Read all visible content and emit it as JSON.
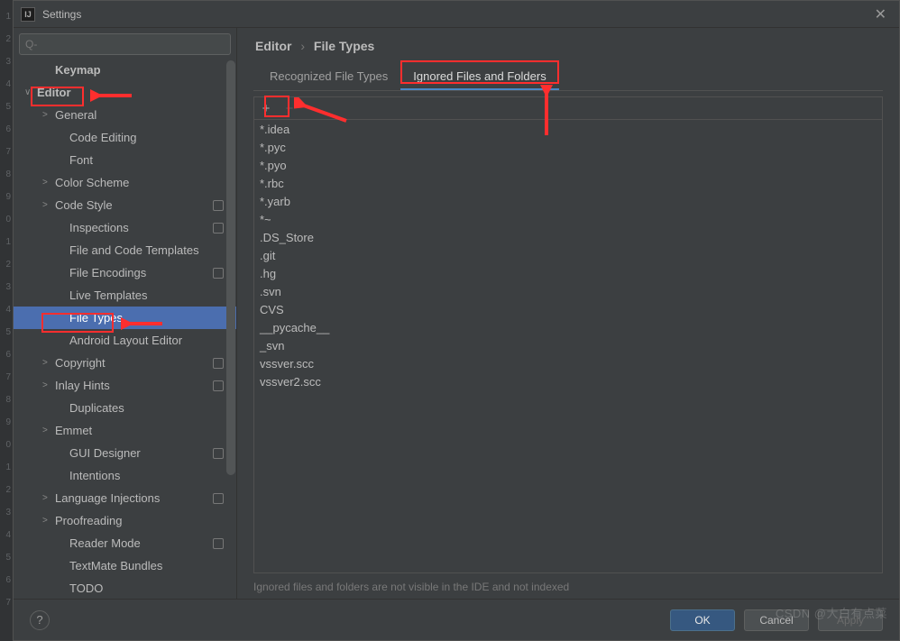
{
  "window": {
    "title": "Settings",
    "close_glyph": "✕",
    "app_glyph": "IJ"
  },
  "search": {
    "placeholder": "Q-"
  },
  "breadcrumb": {
    "a": "Editor",
    "sep": "›",
    "b": "File Types"
  },
  "sidebar": {
    "items": [
      {
        "label": "Keymap",
        "depth": 1,
        "chev": "",
        "bold": true,
        "sel": false,
        "badge": false
      },
      {
        "label": "Editor",
        "depth": 0,
        "chev": "∨",
        "bold": true,
        "sel": false,
        "badge": false
      },
      {
        "label": "General",
        "depth": 1,
        "chev": ">",
        "bold": false,
        "sel": false,
        "badge": false
      },
      {
        "label": "Code Editing",
        "depth": 2,
        "chev": "",
        "bold": false,
        "sel": false,
        "badge": false
      },
      {
        "label": "Font",
        "depth": 2,
        "chev": "",
        "bold": false,
        "sel": false,
        "badge": false
      },
      {
        "label": "Color Scheme",
        "depth": 1,
        "chev": ">",
        "bold": false,
        "sel": false,
        "badge": false
      },
      {
        "label": "Code Style",
        "depth": 1,
        "chev": ">",
        "bold": false,
        "sel": false,
        "badge": true
      },
      {
        "label": "Inspections",
        "depth": 2,
        "chev": "",
        "bold": false,
        "sel": false,
        "badge": true
      },
      {
        "label": "File and Code Templates",
        "depth": 2,
        "chev": "",
        "bold": false,
        "sel": false,
        "badge": false
      },
      {
        "label": "File Encodings",
        "depth": 2,
        "chev": "",
        "bold": false,
        "sel": false,
        "badge": true
      },
      {
        "label": "Live Templates",
        "depth": 2,
        "chev": "",
        "bold": false,
        "sel": false,
        "badge": false
      },
      {
        "label": "File Types",
        "depth": 2,
        "chev": "",
        "bold": false,
        "sel": true,
        "badge": false
      },
      {
        "label": "Android Layout Editor",
        "depth": 2,
        "chev": "",
        "bold": false,
        "sel": false,
        "badge": false
      },
      {
        "label": "Copyright",
        "depth": 1,
        "chev": ">",
        "bold": false,
        "sel": false,
        "badge": true
      },
      {
        "label": "Inlay Hints",
        "depth": 1,
        "chev": ">",
        "bold": false,
        "sel": false,
        "badge": true
      },
      {
        "label": "Duplicates",
        "depth": 2,
        "chev": "",
        "bold": false,
        "sel": false,
        "badge": false
      },
      {
        "label": "Emmet",
        "depth": 1,
        "chev": ">",
        "bold": false,
        "sel": false,
        "badge": false
      },
      {
        "label": "GUI Designer",
        "depth": 2,
        "chev": "",
        "bold": false,
        "sel": false,
        "badge": true
      },
      {
        "label": "Intentions",
        "depth": 2,
        "chev": "",
        "bold": false,
        "sel": false,
        "badge": false
      },
      {
        "label": "Language Injections",
        "depth": 1,
        "chev": ">",
        "bold": false,
        "sel": false,
        "badge": true
      },
      {
        "label": "Proofreading",
        "depth": 1,
        "chev": ">",
        "bold": false,
        "sel": false,
        "badge": false
      },
      {
        "label": "Reader Mode",
        "depth": 2,
        "chev": "",
        "bold": false,
        "sel": false,
        "badge": true
      },
      {
        "label": "TextMate Bundles",
        "depth": 2,
        "chev": "",
        "bold": false,
        "sel": false,
        "badge": false
      },
      {
        "label": "TODO",
        "depth": 2,
        "chev": "",
        "bold": false,
        "sel": false,
        "badge": false
      }
    ]
  },
  "tabs": {
    "recognized": "Recognized File Types",
    "ignored": "Ignored Files and Folders"
  },
  "toolbar": {
    "add": "+",
    "remove": "−"
  },
  "ignored_list": [
    "*.idea",
    "*.pyc",
    "*.pyo",
    "*.rbc",
    "*.yarb",
    "*~",
    ".DS_Store",
    ".git",
    ".hg",
    ".svn",
    "CVS",
    "__pycache__",
    "_svn",
    "vssver.scc",
    "vssver2.scc"
  ],
  "hint": "Ignored files and folders are not visible in the IDE and not indexed",
  "footer": {
    "help": "?",
    "ok": "OK",
    "cancel": "Cancel",
    "apply": "Apply"
  },
  "watermark": "CSDN @大白有点菜"
}
